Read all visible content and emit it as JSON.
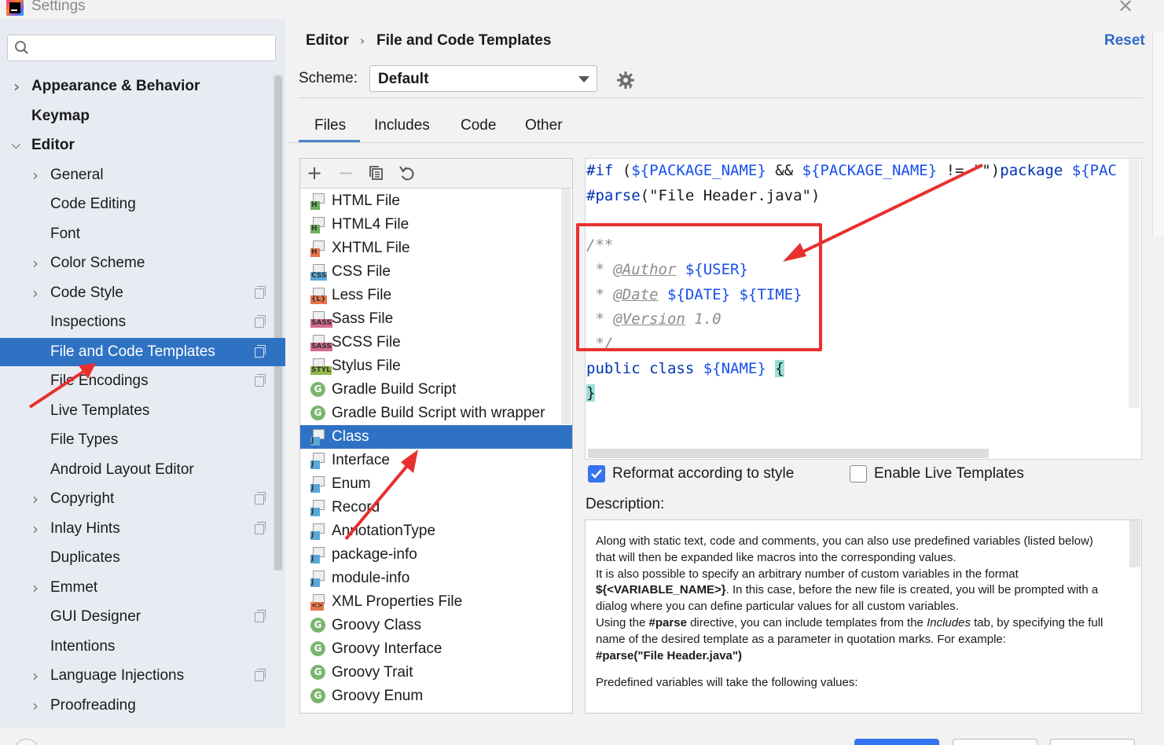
{
  "window": {
    "title": "Settings",
    "close_icon": "close-icon"
  },
  "search": {
    "placeholder": "",
    "value": ""
  },
  "sidebar": {
    "items": [
      {
        "label": "Appearance & Behavior"
      },
      {
        "label": "Keymap"
      },
      {
        "label": "Editor"
      },
      {
        "label": "General"
      },
      {
        "label": "Code Editing"
      },
      {
        "label": "Font"
      },
      {
        "label": "Color Scheme"
      },
      {
        "label": "Code Style"
      },
      {
        "label": "Inspections"
      },
      {
        "label": "File and Code Templates"
      },
      {
        "label": "File Encodings"
      },
      {
        "label": "Live Templates"
      },
      {
        "label": "File Types"
      },
      {
        "label": "Android Layout Editor"
      },
      {
        "label": "Copyright"
      },
      {
        "label": "Inlay Hints"
      },
      {
        "label": "Duplicates"
      },
      {
        "label": "Emmet"
      },
      {
        "label": "GUI Designer"
      },
      {
        "label": "Intentions"
      },
      {
        "label": "Language Injections"
      },
      {
        "label": "Proofreading"
      }
    ],
    "selected": "File and Code Templates"
  },
  "breadcrumb": {
    "parent": "Editor",
    "separator": "›",
    "current": "File and Code Templates"
  },
  "reset_label": "Reset",
  "scheme": {
    "label": "Scheme:",
    "value": "Default"
  },
  "tabs": [
    {
      "label": "Files",
      "active": true
    },
    {
      "label": "Includes",
      "active": false
    },
    {
      "label": "Code",
      "active": false
    },
    {
      "label": "Other",
      "active": false
    }
  ],
  "toolbar": {
    "add": "+",
    "remove": "−",
    "copy": "copy-icon",
    "reset": "undo-icon"
  },
  "templates": [
    {
      "label": "HTML File",
      "badge": "H",
      "color": "#6aae5c"
    },
    {
      "label": "HTML4 File",
      "badge": "H",
      "color": "#6aae5c"
    },
    {
      "label": "XHTML File",
      "badge": "H",
      "color": "#e8754a"
    },
    {
      "label": "CSS File",
      "badge": "CSS",
      "color": "#5aa8d8"
    },
    {
      "label": "Less File",
      "badge": "{L}",
      "color": "#e8754a"
    },
    {
      "label": "Sass File",
      "badge": "SASS",
      "color": "#d46a8c"
    },
    {
      "label": "SCSS File",
      "badge": "SASS",
      "color": "#d46a8c"
    },
    {
      "label": "Stylus File",
      "badge": "STYL",
      "color": "#8fb84a"
    },
    {
      "label": "Gradle Build Script",
      "badge": "G",
      "color": "#7ab56f"
    },
    {
      "label": "Gradle Build Script with wrapper",
      "badge": "G",
      "color": "#7ab56f"
    },
    {
      "label": "Class",
      "badge": "J",
      "color": "#5aa8d8"
    },
    {
      "label": "Interface",
      "badge": "J",
      "color": "#5aa8d8"
    },
    {
      "label": "Enum",
      "badge": "J",
      "color": "#5aa8d8"
    },
    {
      "label": "Record",
      "badge": "J",
      "color": "#5aa8d8"
    },
    {
      "label": "AnnotationType",
      "badge": "J",
      "color": "#5aa8d8"
    },
    {
      "label": "package-info",
      "badge": "J",
      "color": "#5aa8d8"
    },
    {
      "label": "module-info",
      "badge": "J",
      "color": "#5aa8d8"
    },
    {
      "label": "XML Properties File",
      "badge": "<>",
      "color": "#e8754a"
    },
    {
      "label": "Groovy Class",
      "badge": "G",
      "color": "#7ab56f"
    },
    {
      "label": "Groovy Interface",
      "badge": "G",
      "color": "#7ab56f"
    },
    {
      "label": "Groovy Trait",
      "badge": "G",
      "color": "#7ab56f"
    },
    {
      "label": "Groovy Enum",
      "badge": "G",
      "color": "#7ab56f"
    }
  ],
  "selected_template": "Class",
  "code": {
    "l1_kw1": "#if",
    "l1_p1": " (",
    "l1_v1": "${PACKAGE_NAME}",
    "l1_p2": " && ",
    "l1_v2": "${PACKAGE_NAME}",
    "l1_p3": " != \"\")",
    "l1_kw2": "package",
    "l1_v3": " ${PAC",
    "l2_kw": "#parse",
    "l2_rest": "(\"File Header.java\")",
    "l3": "/**",
    "l4_pre": " * ",
    "l4_tag": "@Author",
    "l4_var": " ${USER}",
    "l5_pre": " * ",
    "l5_tag": "@Date",
    "l5_var1": " ${DATE}",
    "l5_var2": " ${TIME}",
    "l6_pre": " * ",
    "l6_tag": "@Version",
    "l6_rest": " 1.0",
    "l7": " */",
    "l8_kw": "public class ",
    "l8_var": "${NAME}",
    "l8_brace": "{",
    "l9_brace": "}"
  },
  "options": {
    "reformat": "Reformat according to style",
    "reformat_checked": true,
    "live": "Enable Live Templates",
    "live_checked": false
  },
  "description": {
    "title": "Description:",
    "p1": "Along with static text, code and comments, you can also use predefined variables (listed below) that will then be expanded like macros into the corresponding values.",
    "p2a": "It is also possible to specify an arbitrary number of custom variables in the format ",
    "p2b": "${<VARIABLE_NAME>}",
    "p2c": ". In this case, before the new file is created, you will be prompted with a dialog where you can define particular values for all custom variables.",
    "p3a": "Using the ",
    "p3b": "#parse",
    "p3c": " directive, you can include templates from the ",
    "p3d": "Includes",
    "p3e": " tab, by specifying the full name of the desired template as a parameter in quotation marks. For example:",
    "p4": "#parse(\"File Header.java\")",
    "p5": "Predefined variables will take the following values:"
  },
  "colors": {
    "accent": "#2f72c4",
    "annotation": "#e8302f",
    "link": "#2e6ac7"
  }
}
